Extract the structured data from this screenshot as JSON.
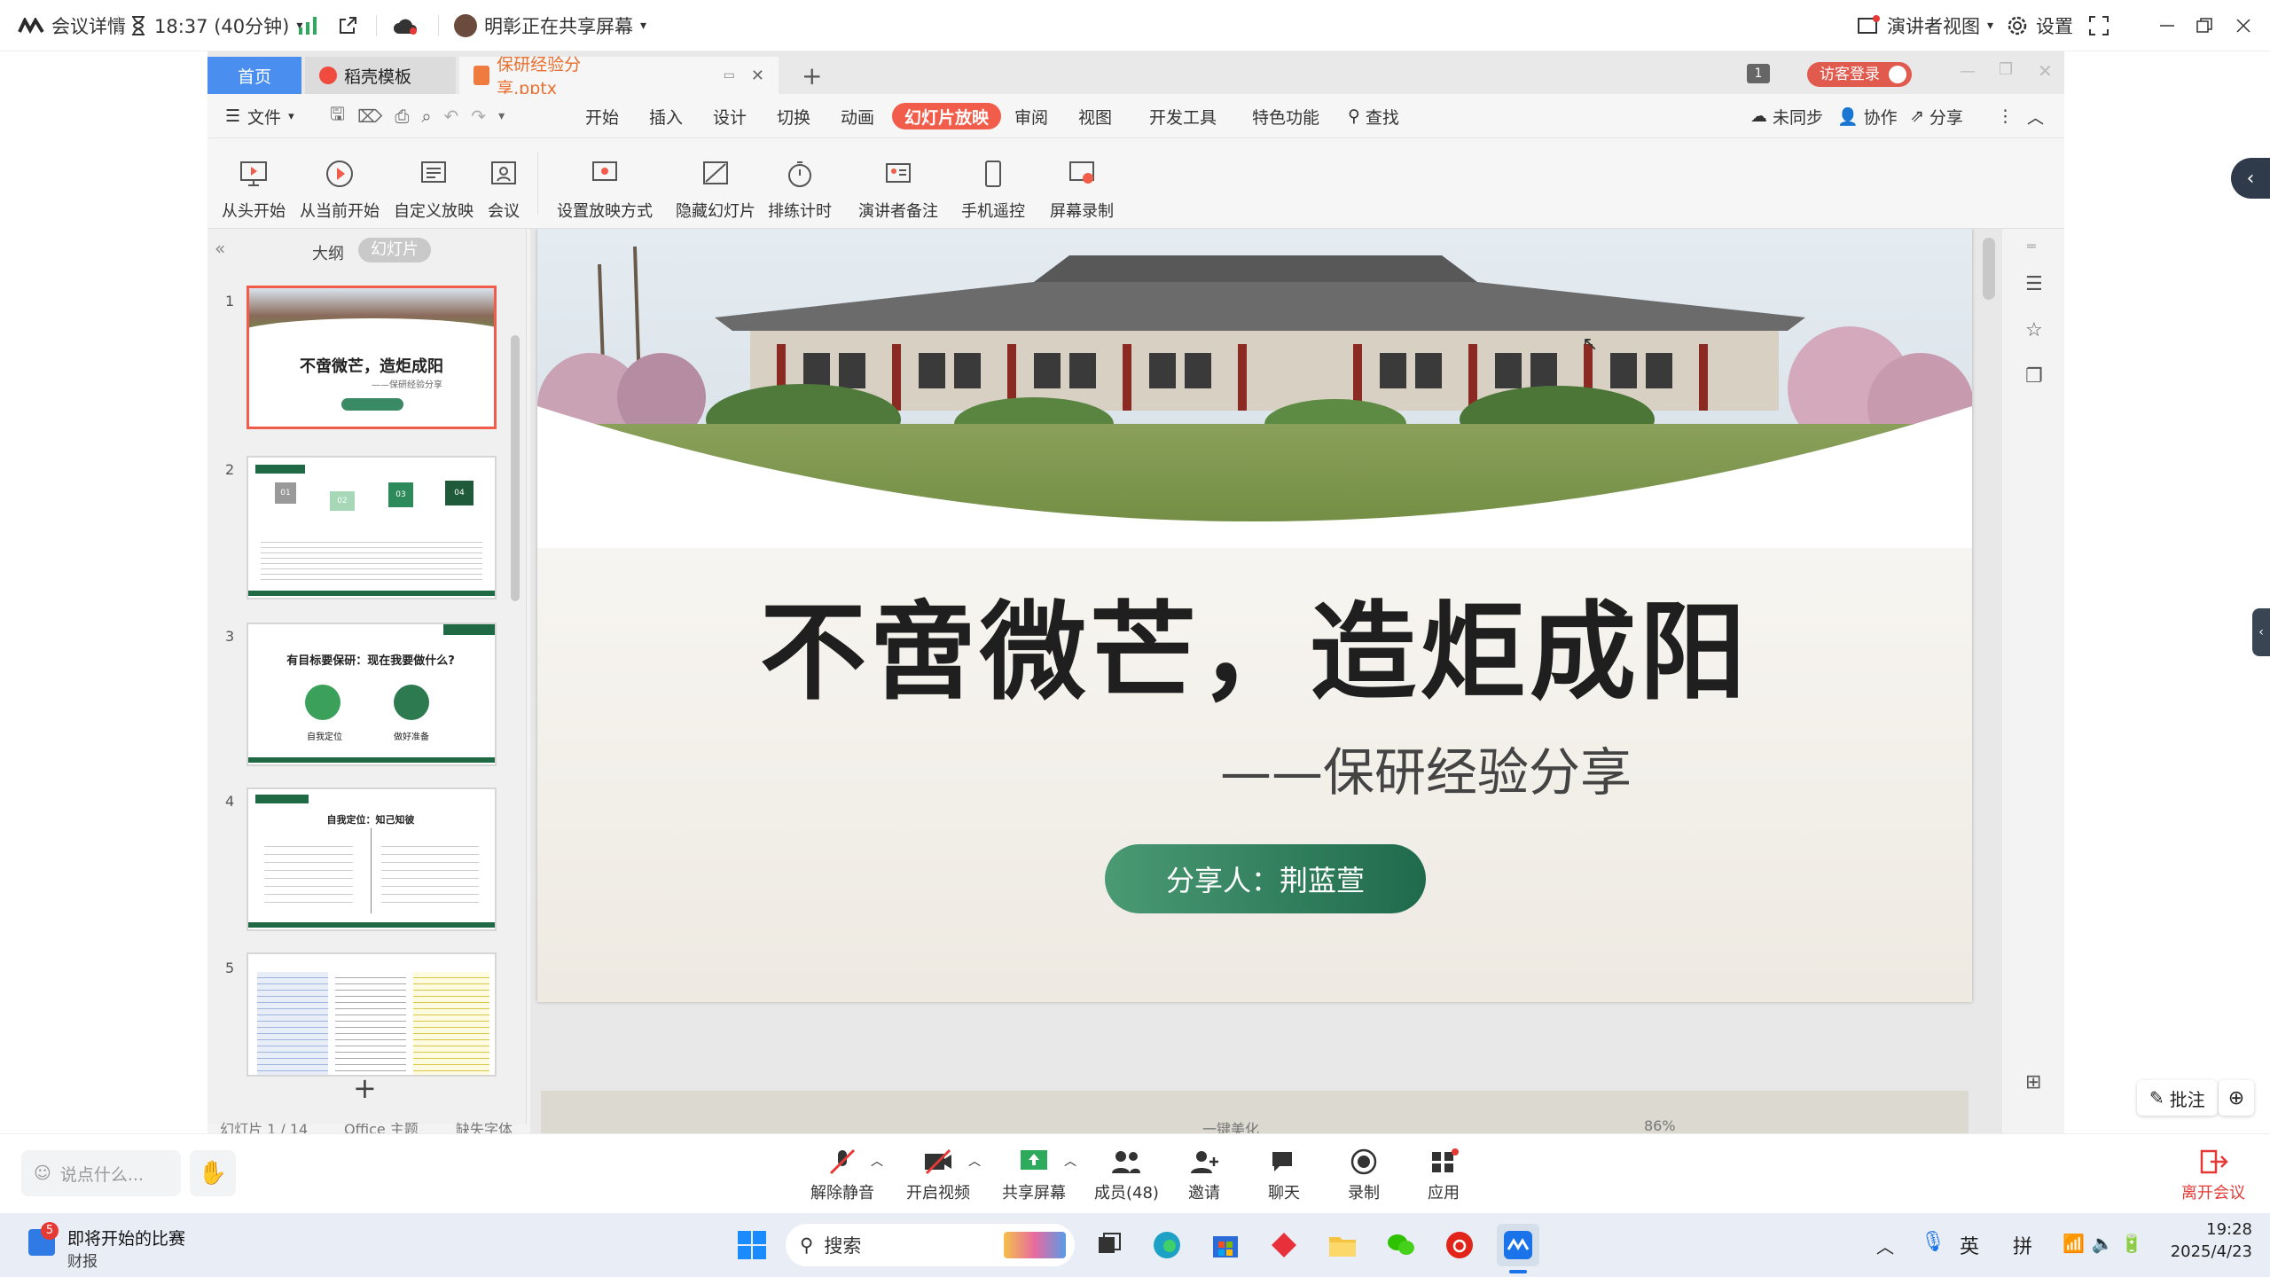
{
  "meeting": {
    "details_label": "会议详情",
    "timer": "18:37 (40分钟)",
    "sharing_text": "明彰正在共享屏幕",
    "presenter_view": "演讲者视图",
    "settings": "设置"
  },
  "wps": {
    "tabs": {
      "home": "首页",
      "template": "稻壳模板",
      "file": "保研经验分享.pptx"
    },
    "window_badge": "1",
    "visitor_login": "访客登录",
    "menu": {
      "file": "文件",
      "items": [
        "开始",
        "插入",
        "设计",
        "切换",
        "动画",
        "幻灯片放映",
        "审阅",
        "视图",
        "开发工具",
        "特色功能"
      ],
      "active": "幻灯片放映",
      "search": "查找",
      "unsynced": "未同步",
      "collab": "协作",
      "share": "分享"
    },
    "ribbon": [
      "从头开始",
      "从当前开始",
      "自定义放映",
      "会议",
      "设置放映方式",
      "隐藏幻灯片",
      "排练计时",
      "演讲者备注",
      "手机遥控",
      "屏幕录制"
    ],
    "panel_tabs": {
      "outline": "大纲",
      "slides": "幻灯片"
    },
    "thumbs": {
      "t1_title": "不啻微芒，造炬成阳",
      "t1_sub": "——保研经验分享",
      "t2_steps": [
        "01",
        "02",
        "03",
        "04"
      ],
      "t3_title": "有目标要保研：现在我要做什么?",
      "t3_label1": "自我定位",
      "t3_label2": "做好准备",
      "t4_title": "自我定位：知己知彼"
    },
    "slide": {
      "title": "不啻微芒，造炬成阳",
      "subtitle": "——保研经验分享",
      "presenter": "分享人：荆蓝萱"
    },
    "status": {
      "slide_count": "幻灯片 1 / 14",
      "theme": "Office 主题",
      "font_missing": "缺失字体",
      "beautify": "一键美化",
      "zoom": "86%"
    },
    "annotate": "批注"
  },
  "meeting_bottom": {
    "chat_placeholder": "说点什么...",
    "buttons": [
      "解除静音",
      "开启视频",
      "共享屏幕",
      "成员(48)",
      "邀请",
      "聊天",
      "录制",
      "应用"
    ],
    "leave": "离开会议"
  },
  "taskbar": {
    "news_badge": "5",
    "news_title": "即将开始的比赛",
    "news_sub": "财报",
    "search_placeholder": "搜索",
    "ime1": "英",
    "ime2": "拼",
    "time": "19:28",
    "date": "2025/4/23"
  },
  "colors": {
    "accent_wps": "#f25c4a",
    "slide_green": "#3a8a66",
    "meeting_blue": "#1a73e8",
    "leave_red": "#e53935"
  }
}
